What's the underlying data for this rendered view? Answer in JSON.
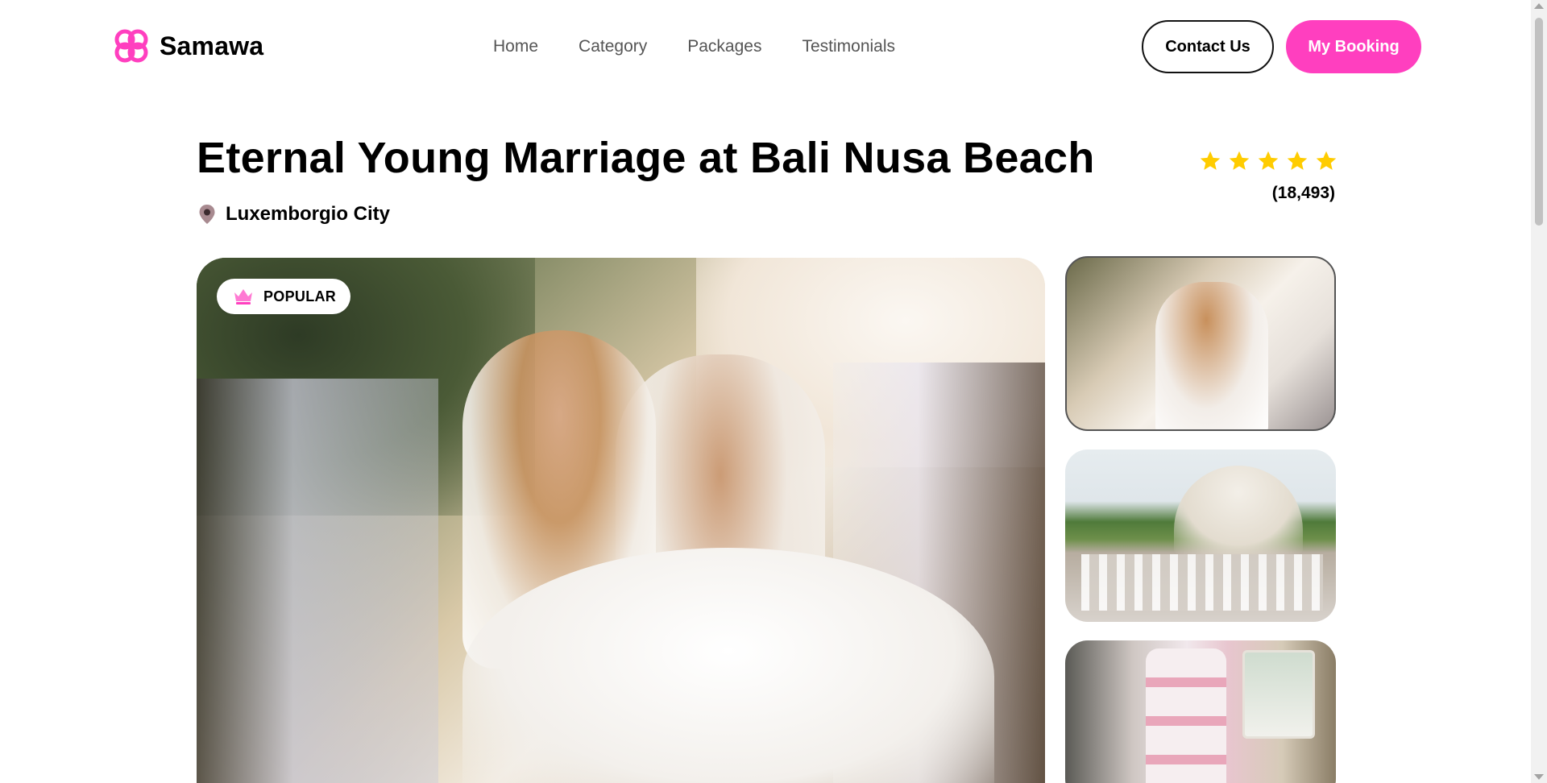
{
  "brand": {
    "name": "Samawa",
    "accent_color": "#ff3fbf"
  },
  "nav": {
    "items": [
      {
        "label": "Home"
      },
      {
        "label": "Category"
      },
      {
        "label": "Packages"
      },
      {
        "label": "Testimonials"
      }
    ]
  },
  "header": {
    "contact_label": "Contact Us",
    "booking_label": "My Booking"
  },
  "package": {
    "title": "Eternal Young Marriage at Bali Nusa Beach",
    "location": "Luxemborgio City",
    "rating_stars": 5,
    "star_color": "#ffcc00",
    "review_count": "(18,493)",
    "badge_label": "POPULAR"
  },
  "gallery": {
    "main_photo": "bride-groom-beach-photo",
    "thumbnails": [
      {
        "name": "couple-with-guests-photo",
        "selected": true
      },
      {
        "name": "gazebo-venue-photo",
        "selected": false
      },
      {
        "name": "wedding-cake-photo",
        "selected": false
      }
    ]
  }
}
